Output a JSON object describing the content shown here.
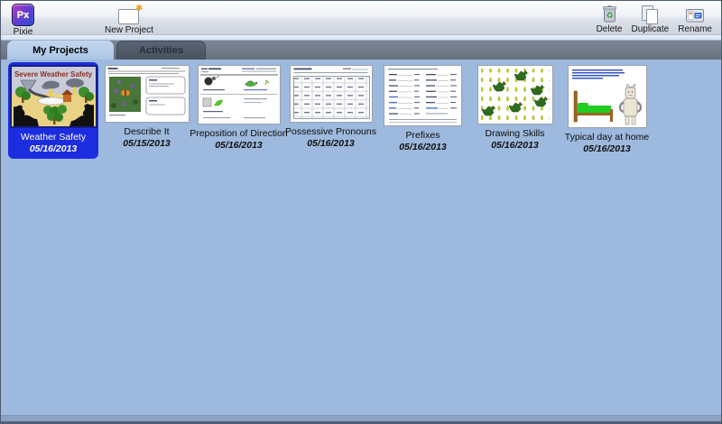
{
  "toolbar": {
    "app": {
      "label": "Pixie",
      "icon_text": "Px"
    },
    "new_project_label": "New Project",
    "delete_label": "Delete",
    "duplicate_label": "Duplicate",
    "rename_label": "Rename"
  },
  "icons": {
    "new_project_star": "✱",
    "recycle_glyph": "♻"
  },
  "tabs": {
    "my_projects": "My Projects",
    "activities": "Activities"
  },
  "projects": [
    {
      "title": "Weather Safety",
      "date": "05/16/2013",
      "selected": true,
      "thumbnail_caption": "Severe Weather Safety"
    },
    {
      "title": "Describe It",
      "date": "05/15/2013",
      "selected": false
    },
    {
      "title": "Preposition of Direction",
      "date": "05/16/2013",
      "selected": false
    },
    {
      "title": "Possessive Pronouns",
      "date": "05/16/2013",
      "selected": false
    },
    {
      "title": "Prefixes",
      "date": "05/16/2013",
      "selected": false
    },
    {
      "title": "Drawing Skills",
      "date": "05/16/2013",
      "selected": false
    },
    {
      "title": "Typical day at home",
      "date": "05/16/2013",
      "selected": false
    }
  ],
  "colors": {
    "selection_blue": "#1c2de0",
    "content_background": "#9db9dd",
    "tabstrip_background": "#6e7887",
    "active_tab": "#b2cbe9",
    "inactive_tab": "#4d5664"
  }
}
